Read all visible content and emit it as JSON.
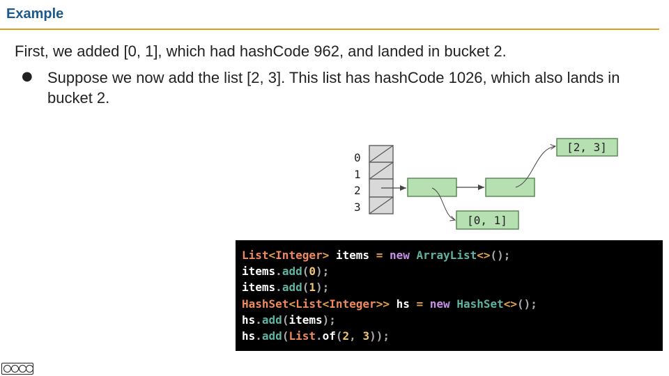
{
  "slide": {
    "title": "Example",
    "line1": "First, we added [0, 1], which had hashCode 962, and landed in bucket 2.",
    "bullet_symbol": "●",
    "bullet_text": "Suppose we now add the list [2, 3]. This list has hashCode 1026, which also lands in bucket 2."
  },
  "diagram": {
    "bucket_indices": [
      "0",
      "1",
      "2",
      "3"
    ],
    "node_upper_label": "[2, 3]",
    "node_lower_label": "[0, 1]"
  },
  "code": {
    "lines": [
      [
        [
          "type",
          "List"
        ],
        [
          "op",
          "<"
        ],
        [
          "type",
          "Integer"
        ],
        [
          "op",
          ">"
        ],
        [
          "id",
          " items "
        ],
        [
          "op",
          "="
        ],
        [
          "id",
          " "
        ],
        [
          "kw",
          "new"
        ],
        [
          "id",
          " "
        ],
        [
          "cls",
          "ArrayList"
        ],
        [
          "op",
          "<>"
        ],
        [
          "punc",
          "();"
        ]
      ],
      [
        [
          "id",
          "items"
        ],
        [
          "punc",
          "."
        ],
        [
          "fn",
          "add"
        ],
        [
          "punc",
          "("
        ],
        [
          "num",
          "0"
        ],
        [
          "punc",
          ");"
        ]
      ],
      [
        [
          "id",
          "items"
        ],
        [
          "punc",
          "."
        ],
        [
          "fn",
          "add"
        ],
        [
          "punc",
          "("
        ],
        [
          "num",
          "1"
        ],
        [
          "punc",
          ");"
        ]
      ],
      [
        [
          "type",
          "HashSet"
        ],
        [
          "op",
          "<"
        ],
        [
          "type",
          "List"
        ],
        [
          "op",
          "<"
        ],
        [
          "type",
          "Integer"
        ],
        [
          "op",
          ">>"
        ],
        [
          "id",
          " hs "
        ],
        [
          "op",
          "="
        ],
        [
          "id",
          " "
        ],
        [
          "kw",
          "new"
        ],
        [
          "id",
          " "
        ],
        [
          "cls",
          "HashSet"
        ],
        [
          "op",
          "<>"
        ],
        [
          "punc",
          "();"
        ]
      ],
      [
        [
          "id",
          "hs"
        ],
        [
          "punc",
          "."
        ],
        [
          "fn",
          "add"
        ],
        [
          "punc",
          "("
        ],
        [
          "id",
          "items"
        ],
        [
          "punc",
          ");"
        ]
      ],
      [
        [
          "id",
          "hs"
        ],
        [
          "punc",
          "."
        ],
        [
          "fn",
          "add"
        ],
        [
          "punc",
          "("
        ],
        [
          "type",
          "List"
        ],
        [
          "punc",
          "."
        ],
        [
          "id",
          "of"
        ],
        [
          "punc",
          "("
        ],
        [
          "num",
          "2"
        ],
        [
          "punc",
          ", "
        ],
        [
          "num",
          "3"
        ],
        [
          "punc",
          "));"
        ]
      ]
    ]
  },
  "colors": {
    "title": "#1c5a8c",
    "rule": "#d4a017",
    "node_fill": "#b7e0b2",
    "node_stroke": "#5a8a55",
    "bucket_fill": "#d9d9d9"
  },
  "footer": {
    "license_icon": "cc-by-nc-sa-icon"
  }
}
